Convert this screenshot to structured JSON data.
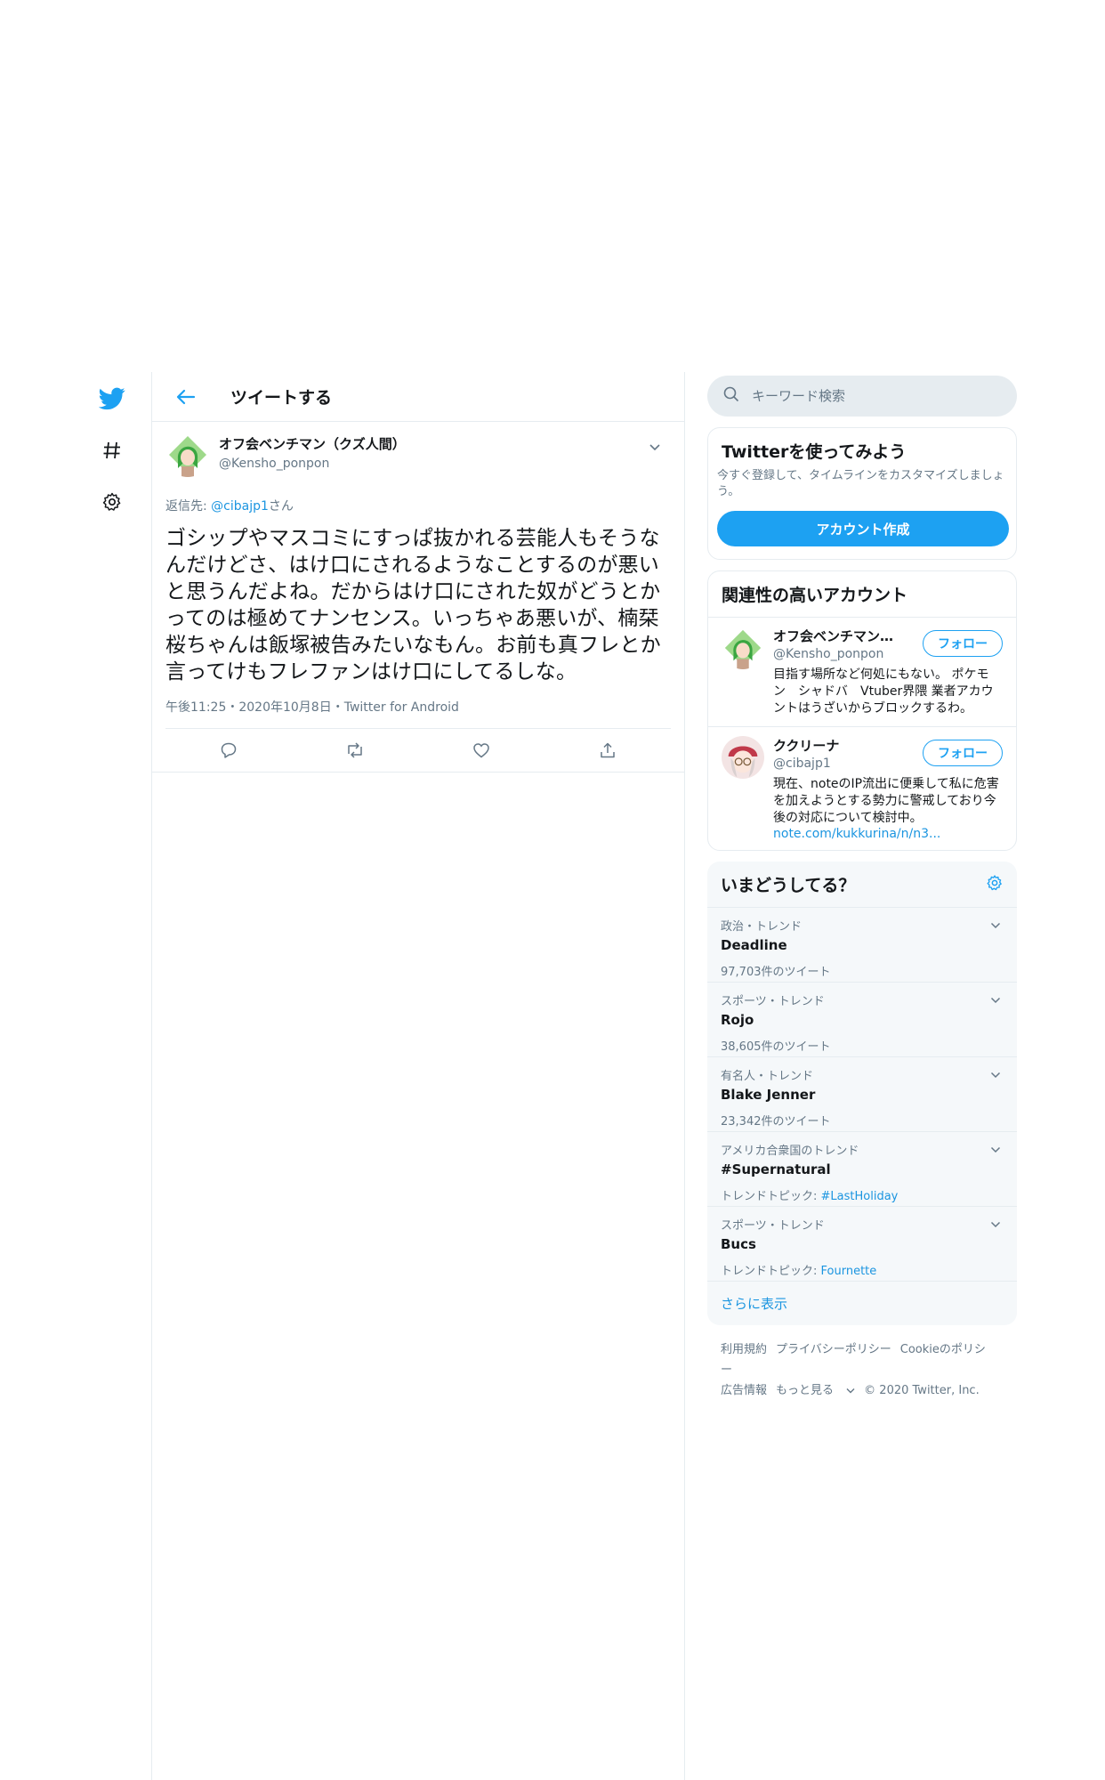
{
  "nav": {
    "items": [
      {
        "icon": "twitter-bird-icon",
        "color": "#1da1f2"
      },
      {
        "icon": "hashtag-icon"
      },
      {
        "icon": "gear-icon"
      }
    ]
  },
  "header": {
    "title": "ツイートする"
  },
  "tweet": {
    "author_name": "オフ会ベンチマン（クズ人間）",
    "author_handle": "@Kensho_ponpon",
    "reply_prefix": "返信先: ",
    "reply_handle": "@cibajp1",
    "reply_suffix": "さん",
    "text": "ゴシップやマスコミにすっぱ抜かれる芸能人もそうなんだけどさ、はけ口にされるようなことするのが悪いと思うんだよね。だからはけ口にされた奴がどうとかってのは極めてナンセンス。いっちゃあ悪いが、楠栞桜ちゃんは飯塚被告みたいなもん。お前も真フレとか言ってけもフレファンはけ口にしてるしな。",
    "time": "午後11:25",
    "date": "2020年10月8日",
    "source": "Twitter for Android",
    "sep": "・"
  },
  "search": {
    "placeholder": "キーワード検索"
  },
  "signup": {
    "title": "Twitterを使ってみよう",
    "description": "今すぐ登録して、タイムラインをカスタマイズしましょう。",
    "button": "アカウント作成"
  },
  "relevant": {
    "title": "関連性の高いアカウント",
    "accounts": [
      {
        "name": "オフ会ベンチマン（...",
        "handle": "@Kensho_ponpon",
        "bio": "目指す場所など何処にもない。 ポケモン　シャドバ　Vtuber界隈 業者アカウントはうざいからブロックするわ。",
        "link": "",
        "follow": "フォロー"
      },
      {
        "name": "ククリーナ",
        "handle": "@cibajp1",
        "bio": "現在、noteのIP流出に便乗して私に危害を加えようとする勢力に警戒しており今後の対応について検討中。",
        "link": "note.com/kukkurina/n/n3...",
        "follow": "フォロー"
      }
    ]
  },
  "trends": {
    "title": "いまどうしてる？",
    "items": [
      {
        "meta": "政治・トレンド",
        "name": "Deadline",
        "count": "97,703件のツイート",
        "topic_label": "",
        "topic": ""
      },
      {
        "meta": "スポーツ・トレンド",
        "name": "Rojo",
        "count": "38,605件のツイート",
        "topic_label": "",
        "topic": ""
      },
      {
        "meta": "有名人・トレンド",
        "name": "Blake Jenner",
        "count": "23,342件のツイート",
        "topic_label": "",
        "topic": ""
      },
      {
        "meta": "アメリカ合衆国のトレンド",
        "name": "#Supernatural",
        "count": "",
        "topic_label": "トレンドトピック: ",
        "topic": "#LastHoliday"
      },
      {
        "meta": "スポーツ・トレンド",
        "name": "Bucs",
        "count": "",
        "topic_label": "トレンドトピック: ",
        "topic": "Fournette"
      }
    ],
    "show_more": "さらに表示"
  },
  "footer": {
    "terms": "利用規約",
    "privacy": "プライバシーポリシー",
    "cookie": "Cookieのポリシー",
    "ads": "広告情報",
    "more": "もっと見る",
    "copyright": "© 2020 Twitter, Inc."
  },
  "colors": {
    "accent": "#1da1f2",
    "link": "#1b95e0",
    "muted": "#657786",
    "border": "#e6ecf0"
  }
}
